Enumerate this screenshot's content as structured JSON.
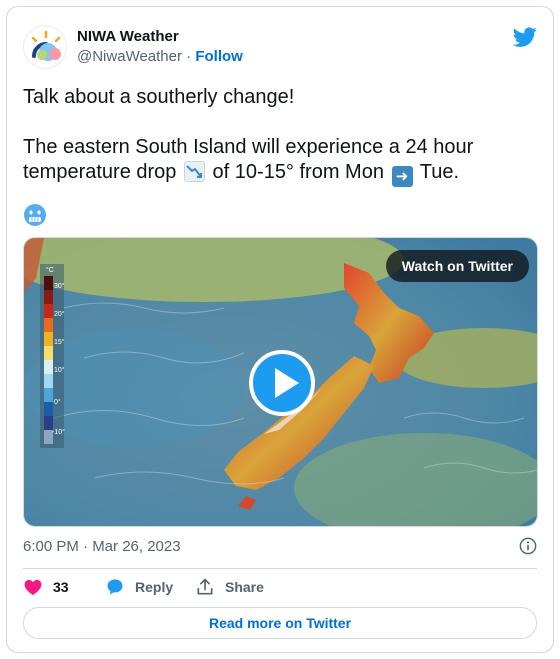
{
  "author": {
    "display_name": "NIWA Weather",
    "handle": "@NiwaWeather",
    "separator": " · ",
    "follow_label": "Follow"
  },
  "tweet": {
    "line1": "Talk about a southerly change!",
    "line2_a": "The eastern South Island will experience a 24 hour",
    "line2_b": "temperature drop",
    "line2_c": "of 10-15° from Mon",
    "line2_d": "Tue.",
    "emoji_chart": "chart-decreasing",
    "emoji_arrow": "right-arrow",
    "emoji_face": "cold-face"
  },
  "media": {
    "watch_label": "Watch on Twitter",
    "legend_unit": "°C",
    "legend_ticks": [
      "30°",
      "20°",
      "15°",
      "10°",
      "0°",
      "-10°"
    ]
  },
  "meta": {
    "timestamp": "6:00 PM · Mar 26, 2023"
  },
  "actions": {
    "likes": "33",
    "reply_label": "Reply",
    "share_label": "Share",
    "read_more_label": "Read more on Twitter"
  },
  "colors": {
    "twitter_blue": "#1d9bf0",
    "like_pink": "#f91880",
    "link_blue": "#006fd6"
  }
}
